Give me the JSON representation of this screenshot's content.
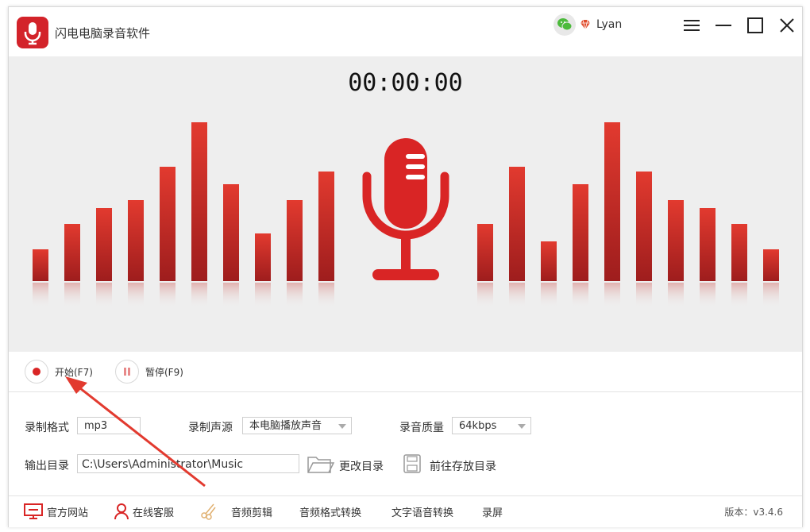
{
  "app": {
    "title": "闪电电脑录音软件"
  },
  "user": {
    "name": "Lyan"
  },
  "timer": "00:00:00",
  "controls": {
    "start_label": "开始(F7)",
    "pause_label": "暂停(F9)"
  },
  "settings": {
    "format_label": "录制格式",
    "format_value": "mp3",
    "source_label": "录制声源",
    "source_value": "本电脑播放声音",
    "quality_label": "录音质量",
    "quality_value": "64kbps",
    "output_label": "输出目录",
    "output_path": "C:\\Users\\Administrator\\Music",
    "change_dir_label": "更改目录",
    "open_dir_label": "前往存放目录"
  },
  "footer": {
    "website": "官方网站",
    "support": "在线客服",
    "audio_cut": "音频剪辑",
    "format_convert": "音频格式转换",
    "tts": "文字语音转换",
    "screen_record": "录屏",
    "version": "版本：v3.4.6"
  },
  "colors": {
    "accent": "#d3232a",
    "bar_top": "#e23a2f",
    "bar_bottom": "#9e1d1d"
  },
  "bars": {
    "levels_left": [
      0.2,
      0.36,
      0.46,
      0.51,
      0.72,
      1.0,
      0.61,
      0.3,
      0.51,
      0.69
    ],
    "levels_right": [
      0.36,
      0.72,
      0.25,
      0.61,
      1.0,
      0.69,
      0.51,
      0.46,
      0.36,
      0.2
    ]
  }
}
